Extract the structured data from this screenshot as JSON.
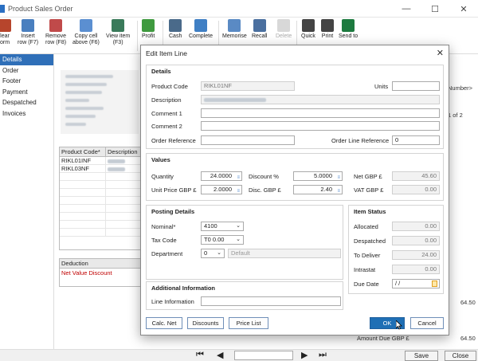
{
  "window": {
    "title": "Product Sales Order",
    "minimize_glyph": "—",
    "maximize_glyph": "☐",
    "close_glyph": "✕"
  },
  "ribbon": {
    "buttons": [
      {
        "id": "clear",
        "line1": "lear",
        "line2": "orm",
        "icon": "clear-form-icon",
        "color": "#b7452c"
      },
      {
        "id": "insert-row",
        "line1": "Insert",
        "line2": "row (F7)",
        "icon": "insert-row-icon",
        "color": "#4a7fbf"
      },
      {
        "id": "remove-row",
        "line1": "Remove",
        "line2": "row (F8)",
        "icon": "remove-row-icon",
        "color": "#c04a4a"
      },
      {
        "id": "copy-cell",
        "line1": "Copy cell",
        "line2": "above (F6)",
        "icon": "copy-cell-icon",
        "color": "#5b8fd1"
      },
      {
        "id": "view-item",
        "line1": "View item",
        "line2": "(F3)",
        "icon": "view-item-icon",
        "color": "#3a7a5a"
      },
      {
        "id": "profit",
        "line1": "Profit",
        "line2": "",
        "icon": "profit-icon",
        "color": "#3f9a3f"
      },
      {
        "id": "cash",
        "line1": "Cash",
        "line2": "",
        "icon": "cash-icon",
        "color": "#4a6a8a"
      },
      {
        "id": "complete",
        "line1": "Complete",
        "line2": "",
        "icon": "complete-icon",
        "color": "#3f7fc4"
      },
      {
        "id": "memorise",
        "line1": "Memorise",
        "line2": "",
        "icon": "memorise-icon",
        "color": "#5a8ac4"
      },
      {
        "id": "recall",
        "line1": "Recall",
        "line2": "",
        "icon": "recall-icon",
        "color": "#4a6f9f"
      },
      {
        "id": "delete",
        "line1": "Delete",
        "line2": "",
        "icon": "delete-icon",
        "color": "#c8c8c8"
      },
      {
        "id": "quick",
        "line1": "Quick",
        "line2": "",
        "icon": "quick-print-icon",
        "color": "#444"
      },
      {
        "id": "print",
        "line1": "Print",
        "line2": "",
        "icon": "print-icon",
        "color": "#444"
      },
      {
        "id": "send-to",
        "line1": "Send to",
        "line2": "",
        "icon": "excel-icon",
        "color": "#1d7a3f"
      }
    ]
  },
  "nav": {
    "items": [
      "Details",
      "Order",
      "Footer",
      "Payment",
      "Despatched",
      "Invoices"
    ],
    "active_color": "#2f6fb8"
  },
  "grid": {
    "headers": [
      "Product Code*",
      "Description"
    ],
    "rows": [
      [
        "RIKL01INF"
      ],
      [
        "RIKL03NF"
      ]
    ]
  },
  "deduction": {
    "header": "Deduction",
    "row": "Net Value Discount"
  },
  "background_right": {
    "number_tag": "Number>",
    "page_of": "1 of 2",
    "value1": "64.50",
    "value2": "64.50",
    "amount_due_label": "Amount Due GBP £"
  },
  "footer": {
    "save_label": "Save",
    "close_label": "Close",
    "first_glyph": "⏮",
    "prev_glyph": "◀",
    "next_glyph": "▶",
    "last_glyph": "⏭"
  },
  "dialog": {
    "title": "Edit Item Line",
    "close_glyph": "✕",
    "details": {
      "title": "Details",
      "product_code_label": "Product Code",
      "product_code": "RIKL01NF",
      "units_label": "Units",
      "units": "",
      "description_label": "Description",
      "comment1_label": "Comment 1",
      "comment2_label": "Comment 2",
      "order_ref_label": "Order Reference",
      "order_line_ref_label": "Order Line Reference",
      "order_line_ref": "0"
    },
    "values": {
      "title": "Values",
      "quantity_label": "Quantity",
      "quantity": "24.0000",
      "discount_pct_label": "Discount %",
      "discount_pct": "5.0000",
      "net_label": "Net GBP £",
      "net": "45.60",
      "unit_price_label": "Unit Price GBP £",
      "unit_price": "2.0000",
      "disc_gbp_label": "Disc. GBP £",
      "disc_gbp": "2.40",
      "vat_label": "VAT GBP £",
      "vat": "0.00"
    },
    "posting": {
      "title": "Posting Details",
      "nominal_label": "Nominal*",
      "nominal": "4100",
      "tax_code_label": "Tax Code",
      "tax_code": "T0  0.00",
      "department_label": "Department",
      "department": "0",
      "department_name": "Default"
    },
    "status": {
      "title": "Item Status",
      "allocated_label": "Allocated",
      "allocated": "0.00",
      "despatched_label": "Despatched",
      "despatched": "0.00",
      "to_deliver_label": "To Deliver",
      "to_deliver": "24.00",
      "intrastat_label": "Intrastat",
      "intrastat": "0.00",
      "due_date_label": "Due Date",
      "due_date": " / /"
    },
    "additional": {
      "title": "Additional Information",
      "line_info_label": "Line Information",
      "line_info": ""
    },
    "buttons": {
      "calc_net": "Calc. Net",
      "discounts": "Discounts",
      "price_list": "Price List",
      "ok": "OK",
      "cancel": "Cancel"
    },
    "dropdown_glyph": "⌄",
    "spin_glyph": "≡"
  }
}
